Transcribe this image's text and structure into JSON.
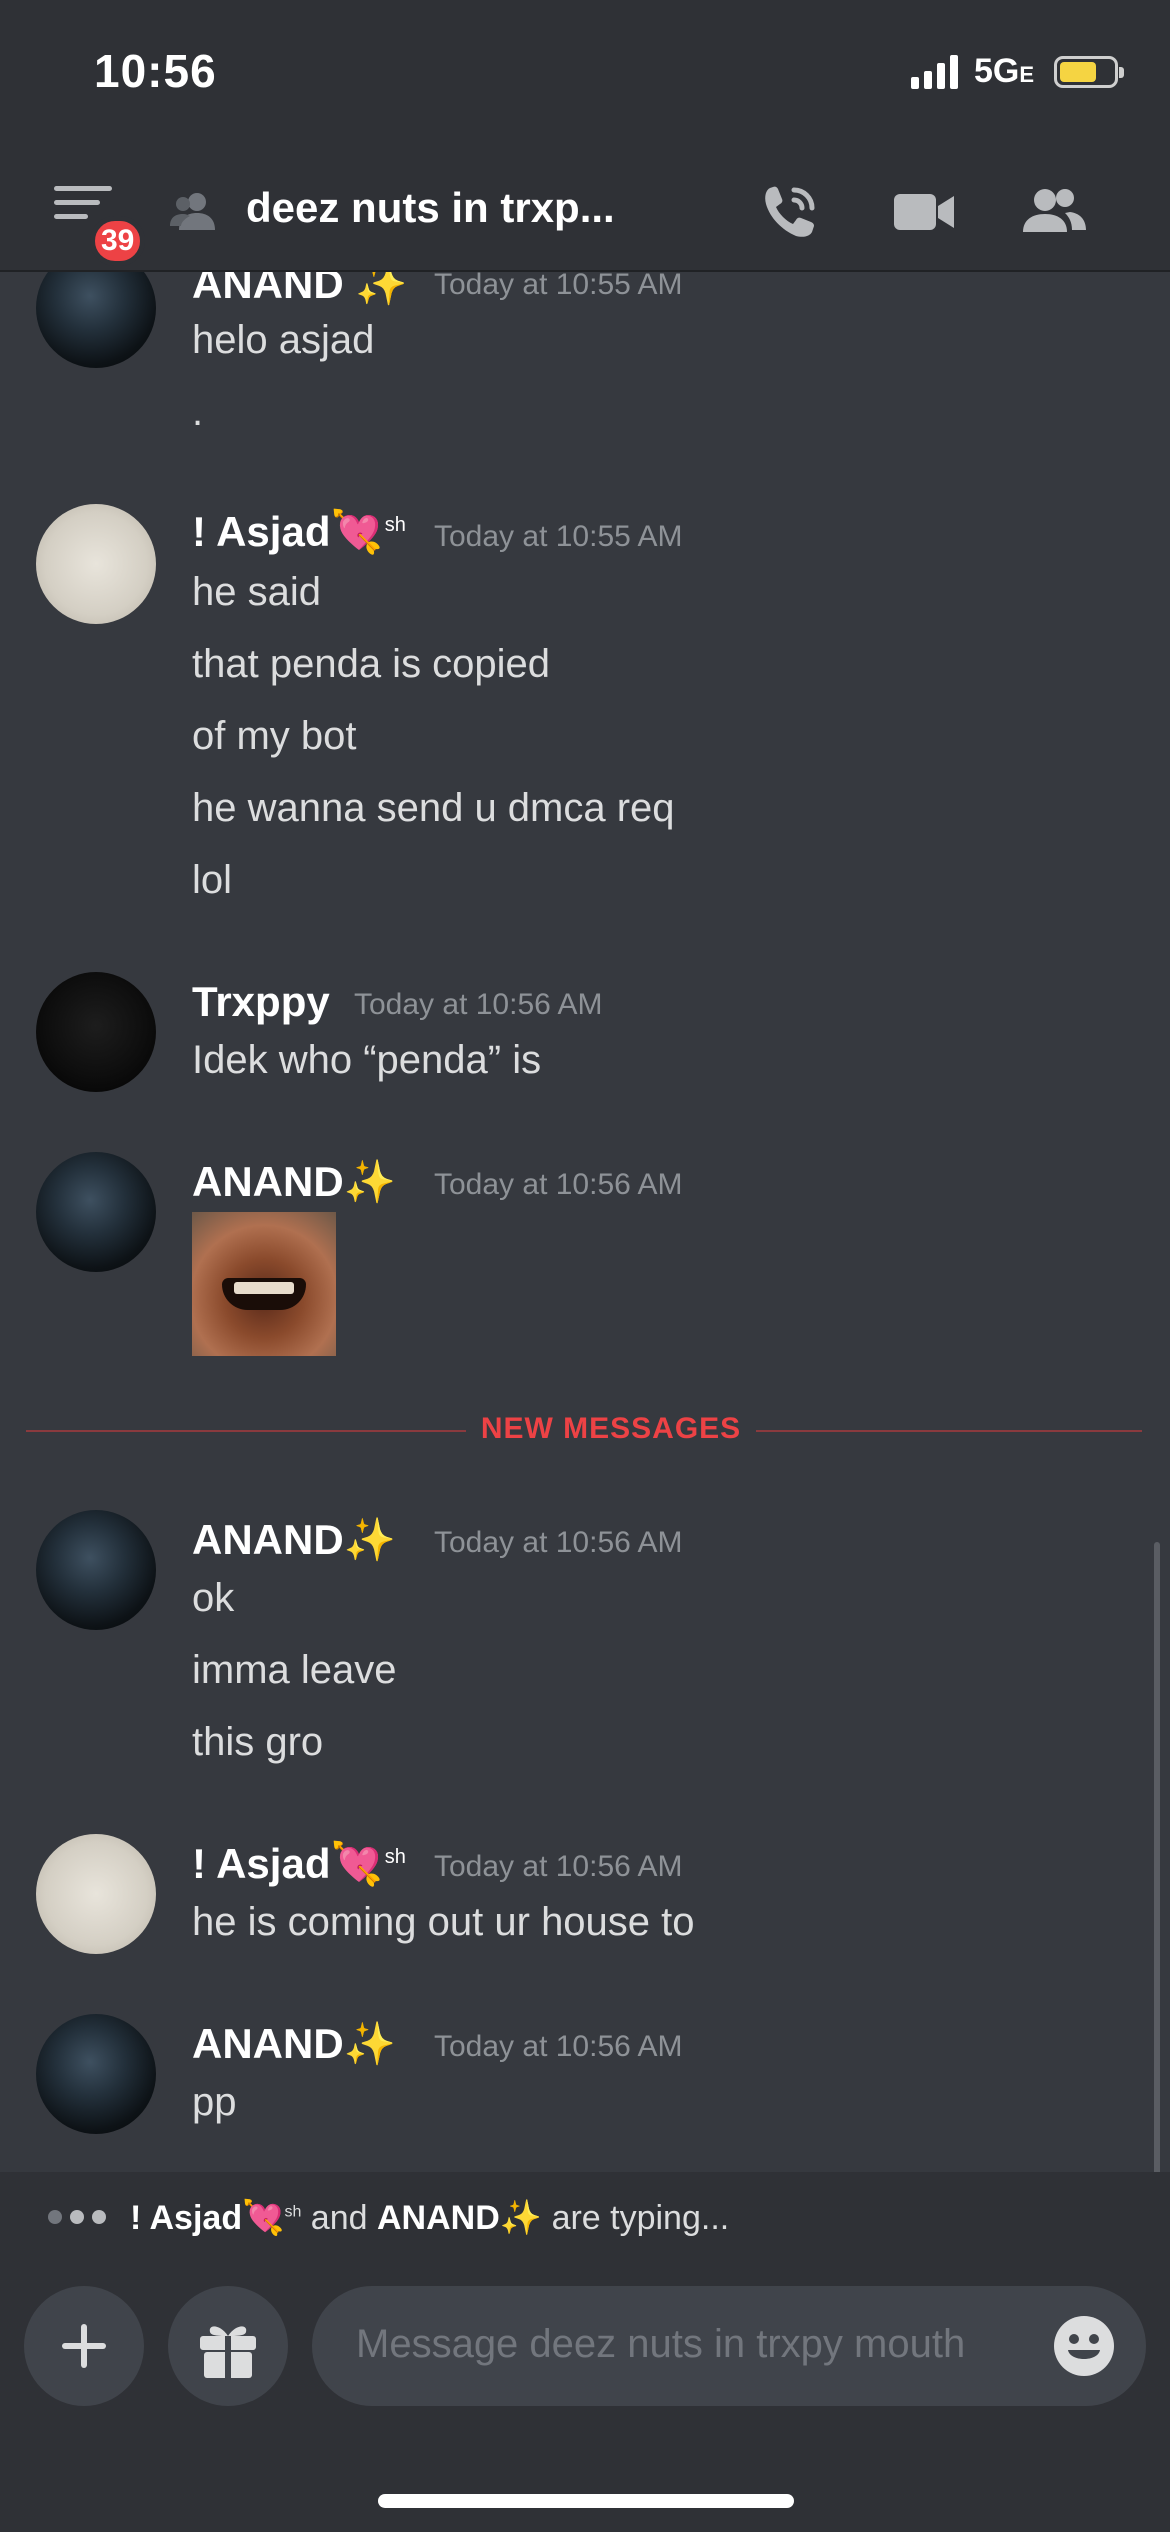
{
  "status_bar": {
    "time": "10:56",
    "network": "5G",
    "network_suffix": "E",
    "battery_percent": 70
  },
  "header": {
    "badge_count": "39",
    "channel_title": "deez nuts in trxp...",
    "icons": [
      "menu-icon",
      "group-dm-icon",
      "call-icon",
      "video-icon",
      "members-icon"
    ]
  },
  "messages": [
    {
      "author": "ANAND",
      "author_emoji": "✨",
      "timestamp": "Today at 10:55 AM",
      "lines": [
        "helo asjad",
        "."
      ]
    },
    {
      "author": "! Asjad",
      "author_emoji": "💘",
      "author_suffix": "sh",
      "timestamp": "Today at 10:55 AM",
      "lines": [
        "he said",
        "that penda is copied",
        "of my bot",
        "he wanna send u dmca req",
        "lol"
      ]
    },
    {
      "author": "Trxppy",
      "timestamp": "Today at 10:56 AM",
      "lines": [
        "Idek who “penda” is"
      ]
    },
    {
      "author": "ANAND",
      "author_emoji": "✨",
      "timestamp": "Today at 10:56 AM",
      "lines": []
    },
    {
      "author": "ANAND",
      "author_emoji": "✨",
      "timestamp": "Today at 10:56 AM",
      "lines": [
        "ok",
        "imma leave",
        "this gro"
      ]
    },
    {
      "author": "! Asjad",
      "author_emoji": "💘",
      "author_suffix": "sh",
      "timestamp": "Today at 10:56 AM",
      "lines": [
        "he is coming out ur house to"
      ]
    },
    {
      "author": "ANAND",
      "author_emoji": "✨",
      "timestamp": "Today at 10:56 AM",
      "lines": [
        "pp"
      ]
    }
  ],
  "new_messages_label": "NEW MESSAGES",
  "typing": {
    "user1": "! Asjad",
    "user1_emoji": "💘",
    "user1_suffix": "sh",
    "joiner": "and",
    "user2": "ANAND",
    "user2_emoji": "✨",
    "suffix": "are typing..."
  },
  "composer": {
    "placeholder": "Message deez nuts in trxpy mouth"
  },
  "colors": {
    "background": "#36393f",
    "header": "#2f3136",
    "badge": "#ed4245",
    "new_messages": "#ed4245"
  }
}
